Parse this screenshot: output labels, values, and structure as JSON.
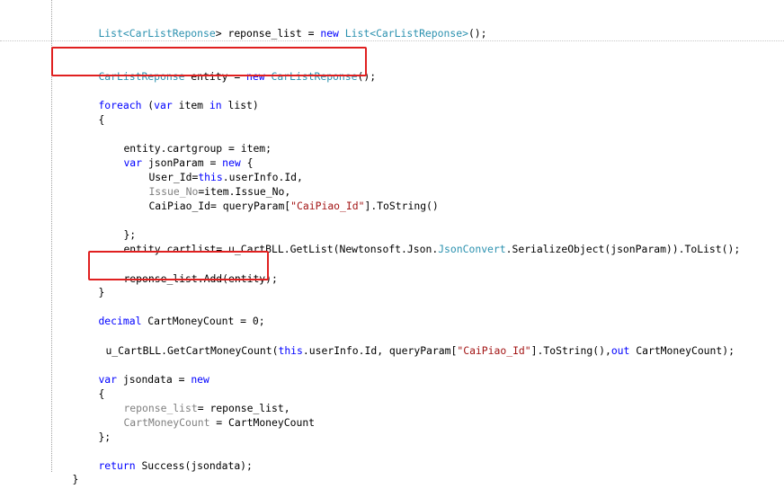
{
  "code": {
    "l1": {
      "t1": "List<",
      "t2": "CarListReponse",
      "t3": "> reponse_list = ",
      "t4": "new",
      "t5": " ",
      "t6": "List<CarListReponse>",
      "t7": "();"
    },
    "l2": {
      "t1": "CarListReponse",
      "t2": " entity = ",
      "t3": "new",
      "t4": " ",
      "t5": "CarListReponse",
      "t6": "();"
    },
    "l3": {
      "t1": "foreach",
      "t2": " (",
      "t3": "var",
      "t4": " item ",
      "t5": "in",
      "t6": " list)"
    },
    "l4": {
      "t1": "{"
    },
    "l5": {
      "t1": "entity.cartgroup = item;"
    },
    "l6": {
      "t1": "var",
      "t2": " jsonParam = ",
      "t3": "new",
      "t4": " {"
    },
    "l7": {
      "t1": "User_Id=",
      "t2": "this",
      "t3": ".userInfo.Id,"
    },
    "l8": {
      "t1": "Issue_No",
      "t2": "=item.Issue_No,"
    },
    "l9": {
      "t1": "CaiPiao_Id= queryParam[",
      "t2": "\"CaiPiao_Id\"",
      "t3": "].ToString()"
    },
    "l10": {
      "t1": "};"
    },
    "l11": {
      "t1": "entity.cartlist= u_CartBLL.GetList(Newtonsoft.Json.",
      "t2": "JsonConvert",
      "t3": ".SerializeObject(jsonParam)).ToList();"
    },
    "l12": {
      "t1": "reponse_list.Add(entity);"
    },
    "l13": {
      "t1": "}"
    },
    "l14": {
      "t1": "decimal",
      "t2": " CartMoneyCount = 0;"
    },
    "l15": {
      "t1": "u_CartBLL.GetCartMoneyCount(",
      "t2": "this",
      "t3": ".userInfo.Id, queryParam[",
      "t4": "\"CaiPiao_Id\"",
      "t5": "].ToString(),",
      "t6": "out",
      "t7": " CartMoneyCount);"
    },
    "l16": {
      "t1": "var",
      "t2": " jsondata = ",
      "t3": "new"
    },
    "l17": {
      "t1": "{"
    },
    "l18": {
      "t1": "reponse_list",
      "t2": "= reponse_list,"
    },
    "l19": {
      "t1": "CartMoneyCount",
      "t2": " = CartMoneyCount"
    },
    "l20": {
      "t1": "};"
    },
    "l21": {
      "t1": "return",
      "t2": " Success(jsondata);"
    },
    "l22": {
      "t1": "}"
    }
  },
  "colors": {
    "keyword": "#0000ff",
    "type": "#2b91af",
    "string": "#a31515",
    "highlight_box": "#e02020"
  }
}
